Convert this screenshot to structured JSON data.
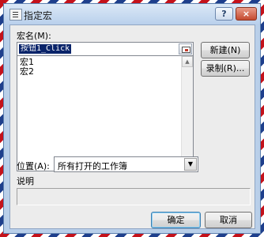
{
  "dialog": {
    "title": "指定宏",
    "help_label": "?",
    "close_label": "×"
  },
  "macro_name": {
    "label": "宏名(M):",
    "value": "按钮1_Click"
  },
  "macro_list": {
    "items": [
      "宏1",
      "宏2"
    ]
  },
  "side_buttons": {
    "new_label": "新建(N)",
    "record_label": "录制(R)..."
  },
  "location": {
    "label": "位置(A):",
    "selected": "所有打开的工作簿"
  },
  "description": {
    "label": "说明"
  },
  "footer": {
    "ok_label": "确定",
    "cancel_label": "取消"
  },
  "icons": {
    "title_icon": "dialog-icon",
    "ref_button": "collapse-dialog-icon",
    "scroll_up": "scroll-up-arrow-icon",
    "scroll_down": "scroll-down-arrow-icon",
    "dropdown": "dropdown-arrow-icon"
  },
  "colors": {
    "selection": "#0a246a",
    "frame": "#b9cfe9",
    "stripe_red": "#c4121b",
    "stripe_blue": "#1e3f8c"
  }
}
